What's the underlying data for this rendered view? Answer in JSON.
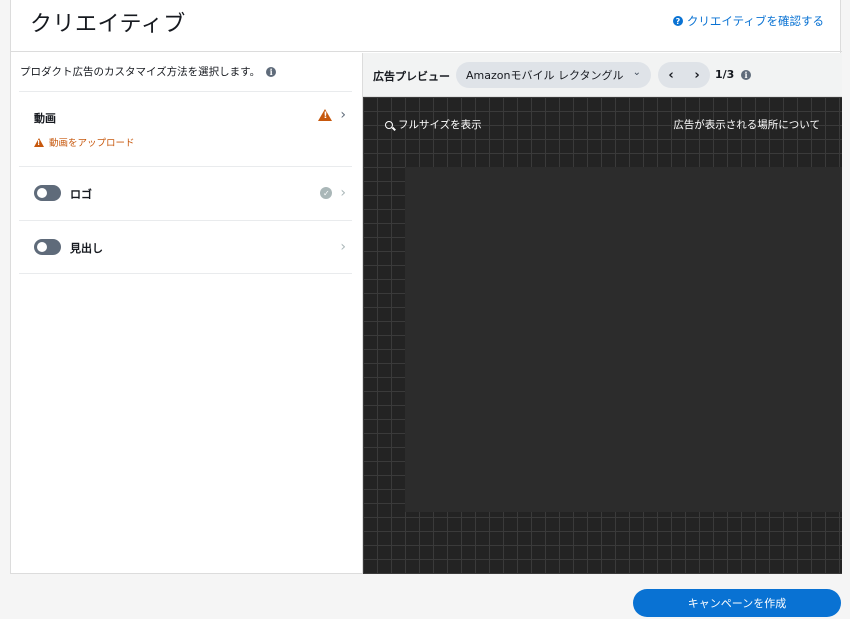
{
  "header": {
    "title": "クリエイティブ",
    "help_link": "クリエイティブを確認する"
  },
  "left_panel": {
    "heading": "プロダクト広告のカスタマイズ方法を選択します。",
    "items": [
      {
        "label": "動画",
        "warning": "動画をアップロード"
      },
      {
        "label": "ロゴ"
      },
      {
        "label": "見出し"
      }
    ]
  },
  "preview": {
    "label": "広告プレビュー",
    "format_select": "Amazonモバイル レクタングル",
    "page_indicator": "1/3",
    "fullsize_link": "フルサイズを表示",
    "placement_link": "広告が表示される場所について"
  },
  "footer": {
    "create_button": "キャンペーンを作成"
  },
  "colors": {
    "accent": "#0972d3",
    "warning": "#c7580d",
    "canvas_bg": "#232323"
  }
}
